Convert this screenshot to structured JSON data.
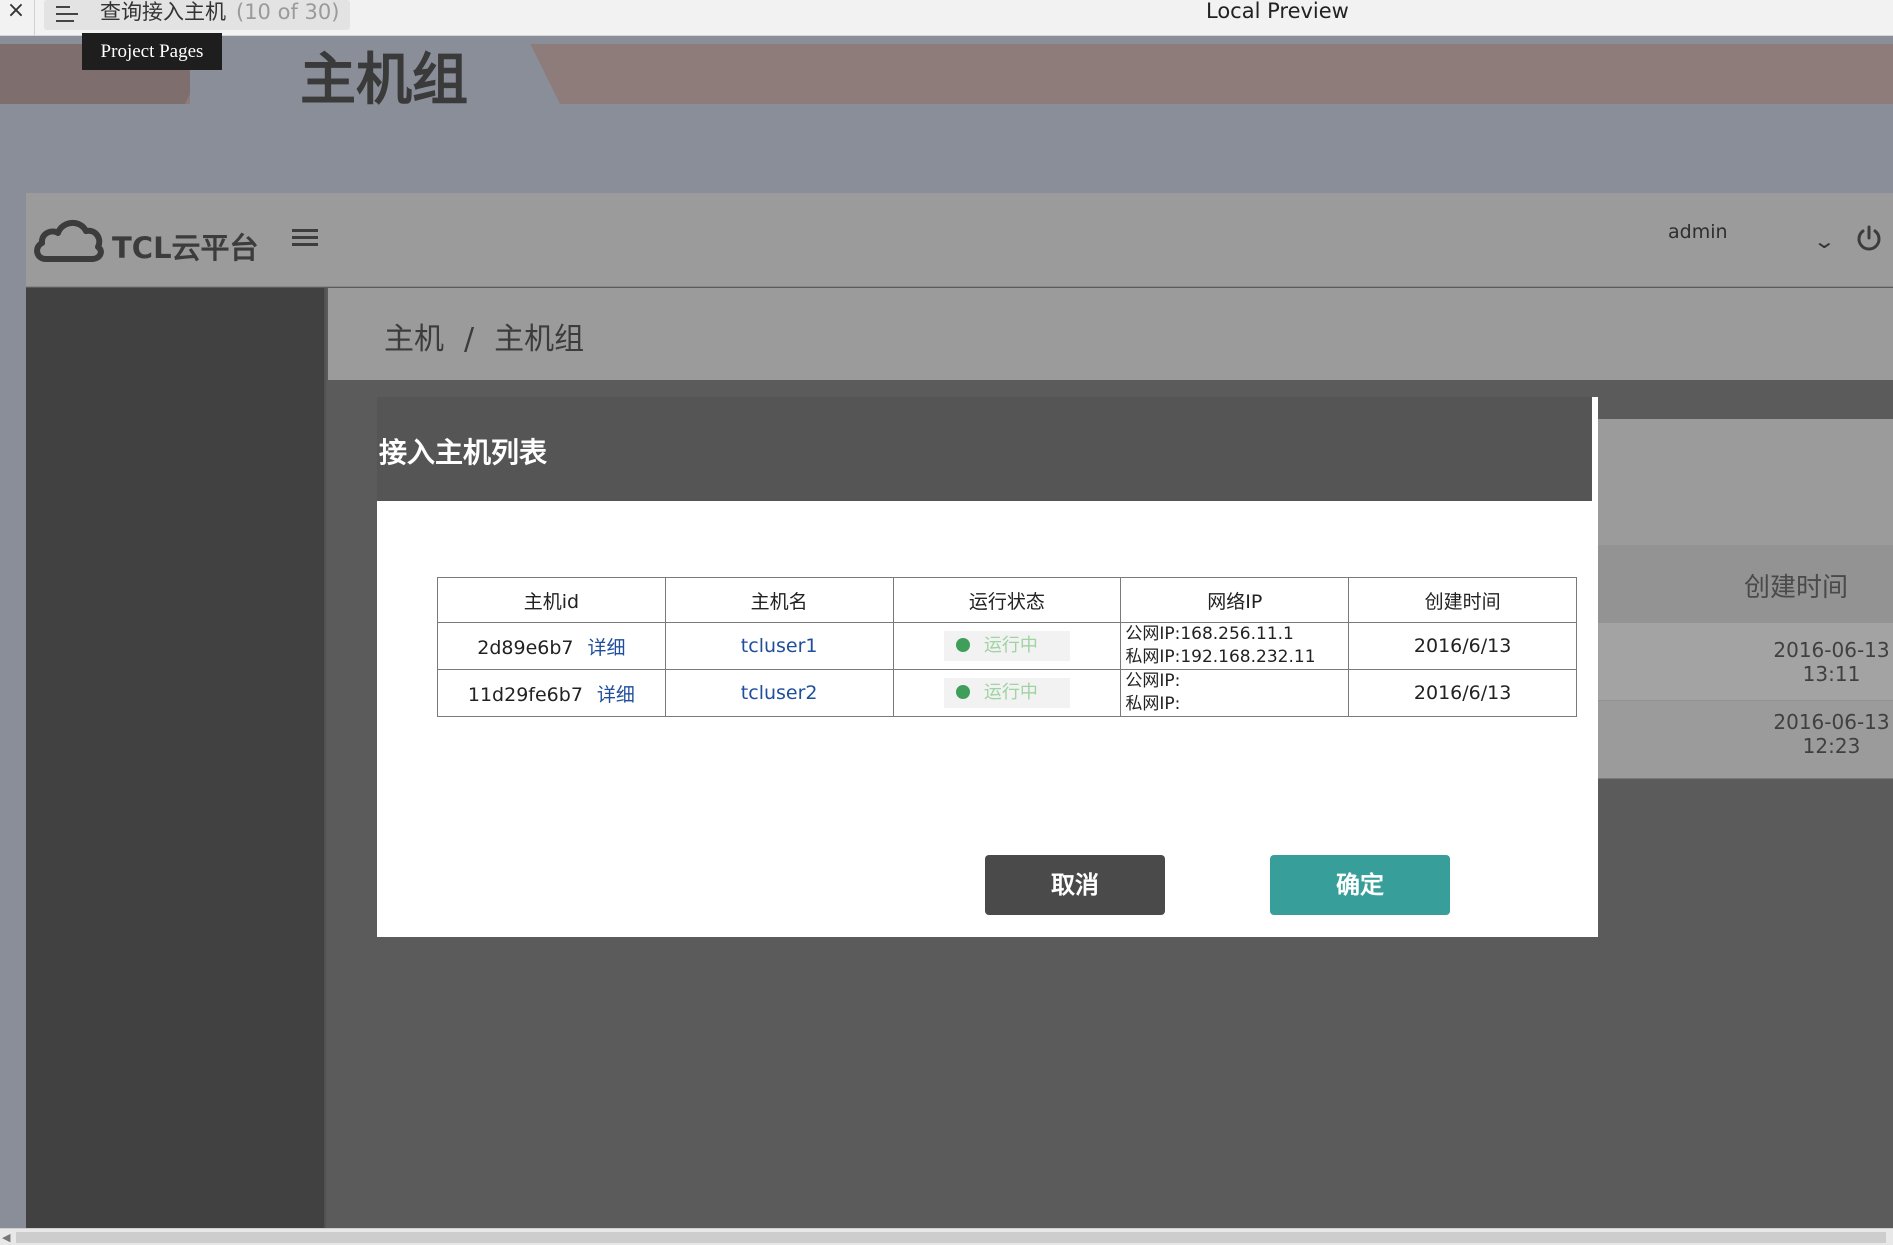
{
  "viewer": {
    "close_glyph": "×",
    "page_title": "查询接入主机",
    "page_count": "(10 of 30)",
    "preview_label": "Local Preview",
    "tooltip": "Project Pages"
  },
  "page": {
    "heading": "主机组"
  },
  "app": {
    "logo_text": "TCL云平台",
    "user": "admin",
    "breadcrumb": {
      "parent": "主机",
      "separator": "/",
      "current": "主机组"
    }
  },
  "background_table": {
    "header": "创建时间",
    "rows": [
      {
        "date": "2016-06-13",
        "time": "13:11"
      },
      {
        "date": "2016-06-13",
        "time": "12:23"
      }
    ]
  },
  "modal": {
    "title": "接入主机列表",
    "columns": [
      "主机id",
      "主机名",
      "运行状态",
      "网络IP",
      "创建时间"
    ],
    "detail_label": "详细",
    "rows": [
      {
        "id": "2d89e6b7",
        "name": "tcluser1",
        "status": "运行中",
        "public_ip": "公网IP:168.256.11.1",
        "private_ip": "私网IP:192.168.232.11",
        "created": "2016/6/13"
      },
      {
        "id": "11d29fe6b7",
        "name": "tcluser2",
        "status": "运行中",
        "public_ip": "公网IP:",
        "private_ip": "私网IP:",
        "created": "2016/6/13"
      }
    ],
    "cancel_label": "取消",
    "ok_label": "确定"
  },
  "colors": {
    "modal_header": "#555555",
    "ok_button": "#379e99",
    "cancel_button": "#4a4a4a",
    "status_dot": "#3e9e5a",
    "link": "#1f4e9c"
  }
}
